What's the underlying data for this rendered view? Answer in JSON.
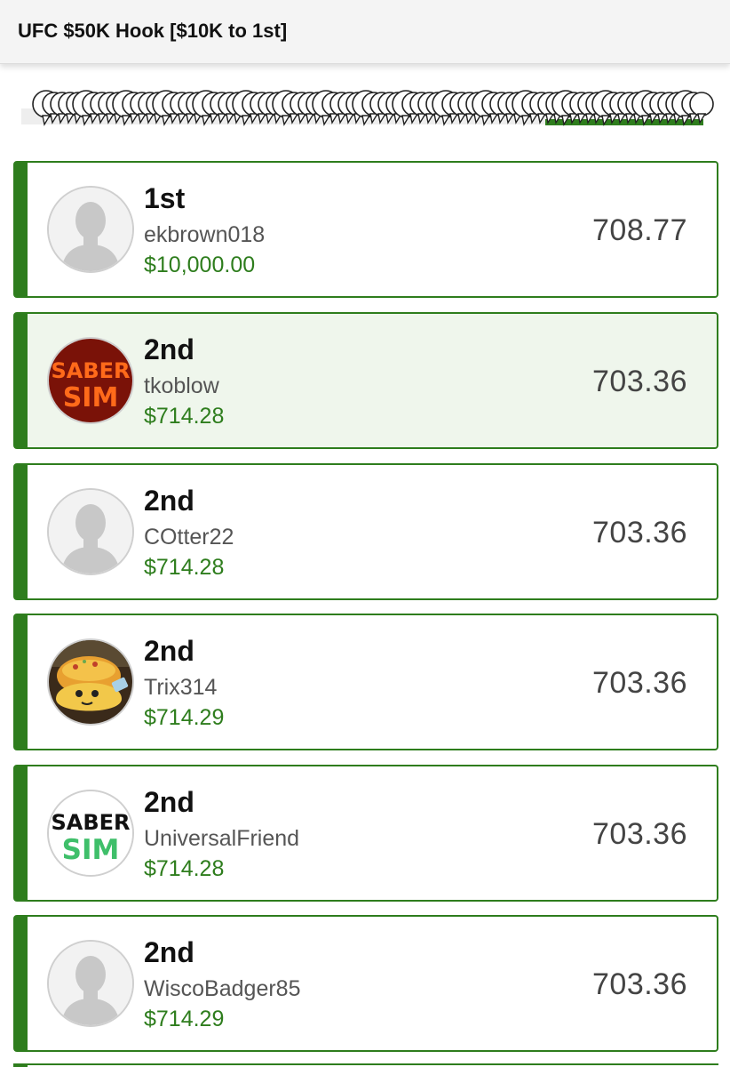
{
  "header": {
    "title": "UFC $50K Hook [$10K to 1st]"
  },
  "colors": {
    "accent": "#2e7d1d",
    "highlight_bg": "#eff6ec"
  },
  "entries": [
    {
      "rank": "1st",
      "username": "ekbrown018",
      "prize": "$10,000.00",
      "score": "708.77",
      "avatar": "default-avatar-icon",
      "highlighted": false
    },
    {
      "rank": "2nd",
      "username": "tkoblow",
      "prize": "$714.28",
      "score": "703.36",
      "avatar": "sabersim-red-logo",
      "avatar_text": [
        "SABER",
        "SIM"
      ],
      "highlighted": true
    },
    {
      "rank": "2nd",
      "username": "COtter22",
      "prize": "$714.28",
      "score": "703.36",
      "avatar": "default-avatar-icon",
      "highlighted": false
    },
    {
      "rank": "2nd",
      "username": "Trix314",
      "prize": "$714.29",
      "score": "703.36",
      "avatar": "taco-photo-avatar",
      "highlighted": false
    },
    {
      "rank": "2nd",
      "username": "UniversalFriend",
      "prize": "$714.28",
      "score": "703.36",
      "avatar": "sabersim-white-logo",
      "avatar_text": [
        "SABER",
        "SIM"
      ],
      "highlighted": false
    },
    {
      "rank": "2nd",
      "username": "WiscoBadger85",
      "prize": "$714.29",
      "score": "703.36",
      "avatar": "default-avatar-icon",
      "highlighted": false
    }
  ]
}
